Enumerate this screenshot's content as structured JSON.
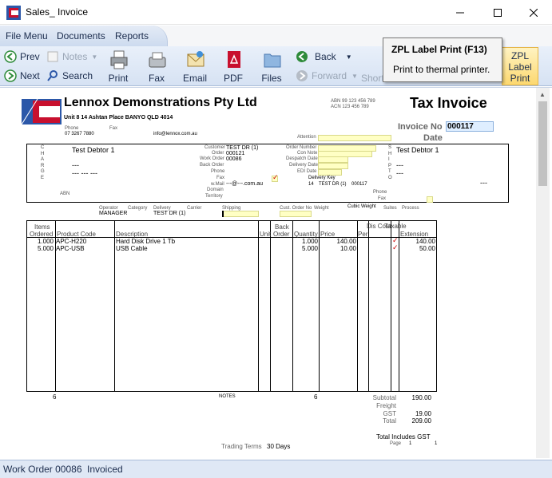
{
  "window": {
    "title": "Sales_ Invoice"
  },
  "menu": {
    "file": "File Menu",
    "documents": "Documents",
    "reports": "Reports"
  },
  "ribbon": {
    "prev": "Prev",
    "next": "Next",
    "notes": "Notes",
    "search": "Search",
    "print": "Print",
    "fax": "Fax",
    "email": "Email",
    "pdf": "PDF",
    "files": "Files",
    "back": "Back",
    "forward": "Forward",
    "short": "Short",
    "zpl1": "ZPL",
    "zpl2": "Label",
    "zpl3": "Print"
  },
  "tooltip": {
    "title": "ZPL Label Print (F13)",
    "body": "Print to thermal printer."
  },
  "invoice": {
    "company": "Lennox Demonstrations Pty Ltd",
    "address": "Unit 8 14 Ashtan Place BANYO QLD 4014",
    "abn": "ABN 99 123 456 789",
    "acn": "ACN 123 456 789",
    "doc_title": "Tax Invoice",
    "phone_label": "Phone",
    "phone": "07 3267 7880",
    "fax_label": "Fax",
    "email": "info@lennox.com.au",
    "invoice_no_label": "Invoice No",
    "invoice_no": "000117",
    "date_label": "Date",
    "attention_label": "Attention",
    "left_code": [
      "C",
      "H",
      "A",
      "R",
      "G",
      "E"
    ],
    "right_code": [
      "S",
      "H",
      "I",
      "P",
      "",
      "T",
      "O"
    ],
    "bill_name": "Test Debtor 1",
    "bill_dash1": "---",
    "bill_dash2": "--- --- ---",
    "ship_name": "Test Debtor 1",
    "ship_dash1": "---",
    "ship_dash2": "---",
    "ship_dash3": "---",
    "abn_label": "ABN",
    "customer_label": "Customer",
    "customer": "TEST DR (1)",
    "order_label": "Order",
    "order": "000121",
    "work_order_label": "Work Order",
    "work_order": "00086",
    "back_order_label": "Back Order",
    "phone2_label": "Phone",
    "fax2_label": "Fax",
    "wmail_label": "w.Mail",
    "wmail": "---@---.com.au",
    "domain_label": "Domain",
    "territory_label": "Territory",
    "order_number_label": "Order Number",
    "con_note_label": "Con Note",
    "despatch_label": "Despatch Date",
    "delivery_date_label": "Delivery Date",
    "edi_label": "EDI Date",
    "delivery_key_label": "Delivery Key",
    "delivery_key_num": "14",
    "delivery_key_cust": "TEST DR (1)",
    "delivery_key_order": "000117",
    "phone3_label": "Phone",
    "fax3_label": "Fax",
    "operator_label": "Operator",
    "operator": "MANAGER",
    "category_label": "Category",
    "delivery_label": "Delivery",
    "delivery": "TEST DR (1)",
    "carrier_label": "Carrier",
    "shipping_label": "Shipping",
    "cust_order_label": "Cust. Order No",
    "weight_label": "Weight",
    "cubic_label": "Cubic Weight",
    "suites_label": "Suites",
    "process_label": "Process"
  },
  "lines": {
    "headers": {
      "items": "Items",
      "ordered": "Ordered",
      "product_code": "Product Code",
      "description": "Description",
      "unit": "Unit",
      "back": "Back",
      "back_order": "Order",
      "quantity": "Quantity",
      "price": "Price",
      "dis": "Dis Cost",
      "per": "Per",
      "taxable": "Taxable",
      "extension": "Extension"
    },
    "rows": [
      {
        "ordered": "1.000",
        "code": "APC-H220",
        "desc": "Hard Disk Drive 1 Tb",
        "qty": "1.000",
        "price": "140.00",
        "ext": "140.00"
      },
      {
        "ordered": "5.000",
        "code": "APC-USB",
        "desc": "USB Cable",
        "qty": "5.000",
        "price": "10.00",
        "ext": "50.00"
      }
    ],
    "total_ordered": "6",
    "notes_label": "NOTES",
    "total_qty": "6"
  },
  "totals": {
    "subtotal_label": "Subtotal",
    "subtotal": "190.00",
    "freight_label": "Freight",
    "gst_label": "GST",
    "gst": "19.00",
    "total_label": "Total",
    "total": "209.00",
    "includes_gst": "Total Includes GST",
    "page_label": "Page",
    "page_num": "1",
    "page_total": "1",
    "terms_label": "Trading Terms",
    "terms": "30 Days"
  },
  "status": {
    "work_order": "Work Order 00086",
    "state": "Invoiced"
  },
  "colors": {
    "ribbon": "#d6e2f3",
    "yellow_field": "#ffffc4",
    "logo_red": "#c8102e",
    "zpl_highlight": "#fcd870"
  }
}
